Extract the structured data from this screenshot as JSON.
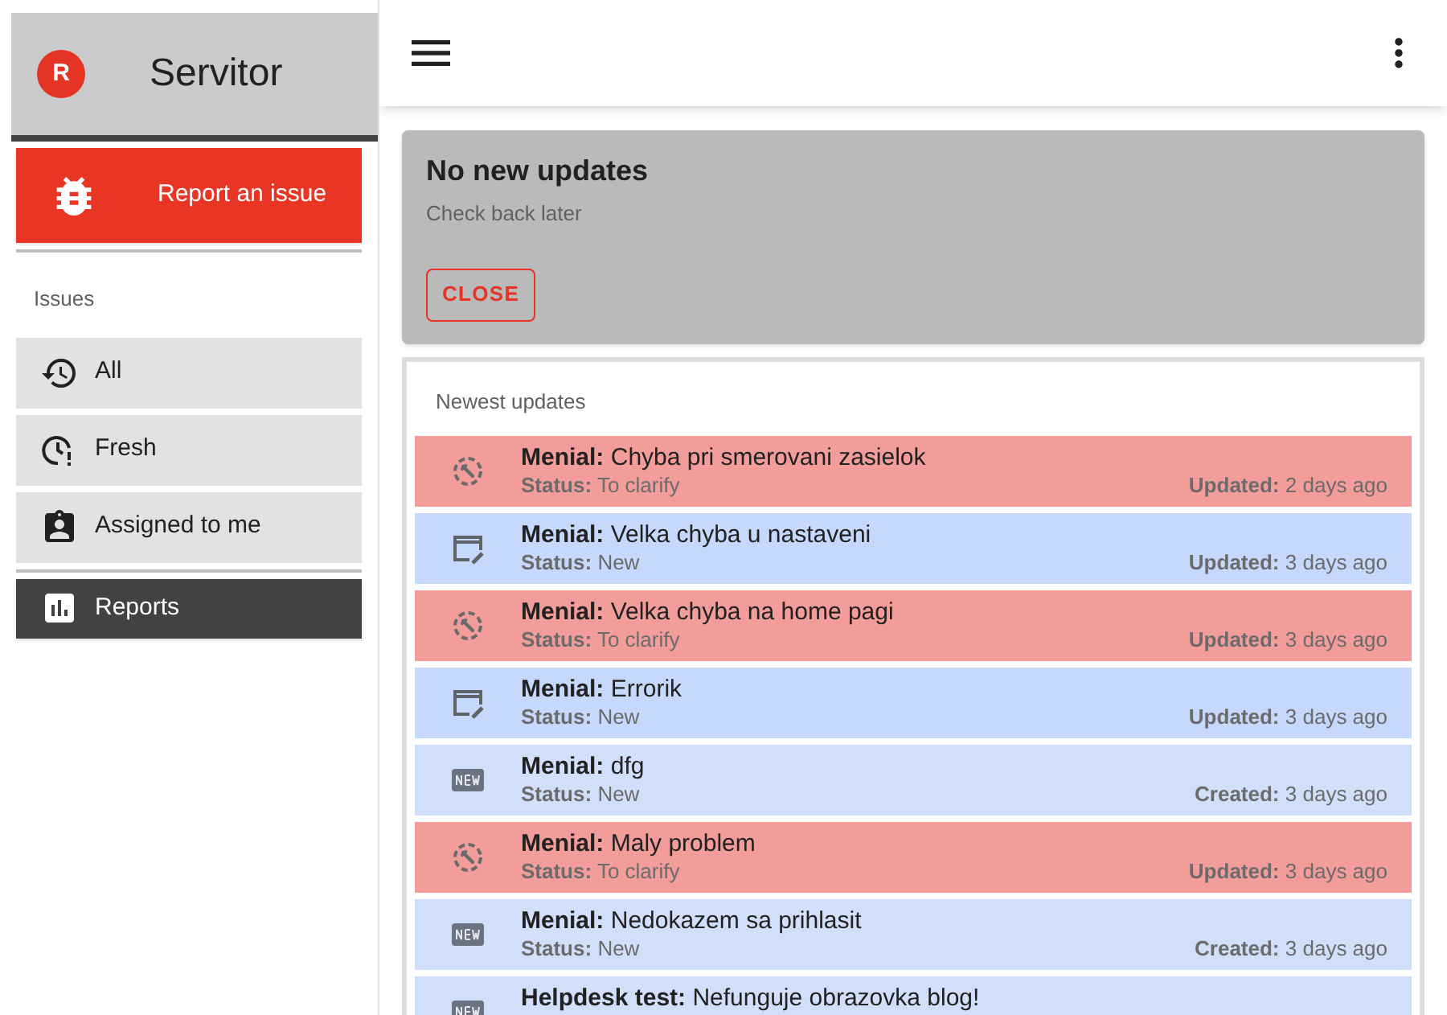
{
  "sidebar": {
    "app_title": "Servitor",
    "logo_letter": "R",
    "report_button": "Report an issue",
    "section_label": "Issues",
    "items": [
      {
        "label": "All",
        "kind": "history"
      },
      {
        "label": "Fresh",
        "kind": "fresh"
      },
      {
        "label": "Assigned to me",
        "kind": "assigned"
      }
    ],
    "reports": {
      "label": "Reports"
    }
  },
  "notice": {
    "title": "No new updates",
    "subtitle": "Check back later",
    "button": "CLOSE"
  },
  "updates": {
    "title": "Newest updates",
    "rows": [
      {
        "kind": "clarify",
        "color": "#f29d9a",
        "project": "Menial:",
        "title": "Chyba pri smerovani zasielok",
        "status_label": "Status:",
        "status": "To clarify",
        "date_label": "Updated:",
        "date": "2 days ago"
      },
      {
        "kind": "edit",
        "color": "#c6d8fb",
        "project": "Menial:",
        "title": "Velka chyba u nastaveni",
        "status_label": "Status:",
        "status": "New",
        "date_label": "Updated:",
        "date": "3 days ago"
      },
      {
        "kind": "clarify",
        "color": "#f29d9a",
        "project": "Menial:",
        "title": "Velka chyba na home pagi",
        "status_label": "Status:",
        "status": "To clarify",
        "date_label": "Updated:",
        "date": "3 days ago"
      },
      {
        "kind": "edit",
        "color": "#c6d8fb",
        "project": "Menial:",
        "title": "Errorik",
        "status_label": "Status:",
        "status": "New",
        "date_label": "Updated:",
        "date": "3 days ago"
      },
      {
        "kind": "new",
        "color": "#d2dffb",
        "project": "Menial:",
        "title": "dfg",
        "status_label": "Status:",
        "status": "New",
        "date_label": "Created:",
        "date": "3 days ago"
      },
      {
        "kind": "clarify",
        "color": "#f29d9a",
        "project": "Menial:",
        "title": "Maly problem",
        "status_label": "Status:",
        "status": "To clarify",
        "date_label": "Updated:",
        "date": "3 days ago"
      },
      {
        "kind": "new",
        "color": "#d2dffb",
        "project": "Menial:",
        "title": "Nedokazem sa prihlasit",
        "status_label": "Status:",
        "status": "New",
        "date_label": "Created:",
        "date": "3 days ago"
      },
      {
        "kind": "new",
        "color": "#d2dffb",
        "project": "Helpdesk test:",
        "title": "Nefunguje obrazovka blog!"
      }
    ]
  }
}
